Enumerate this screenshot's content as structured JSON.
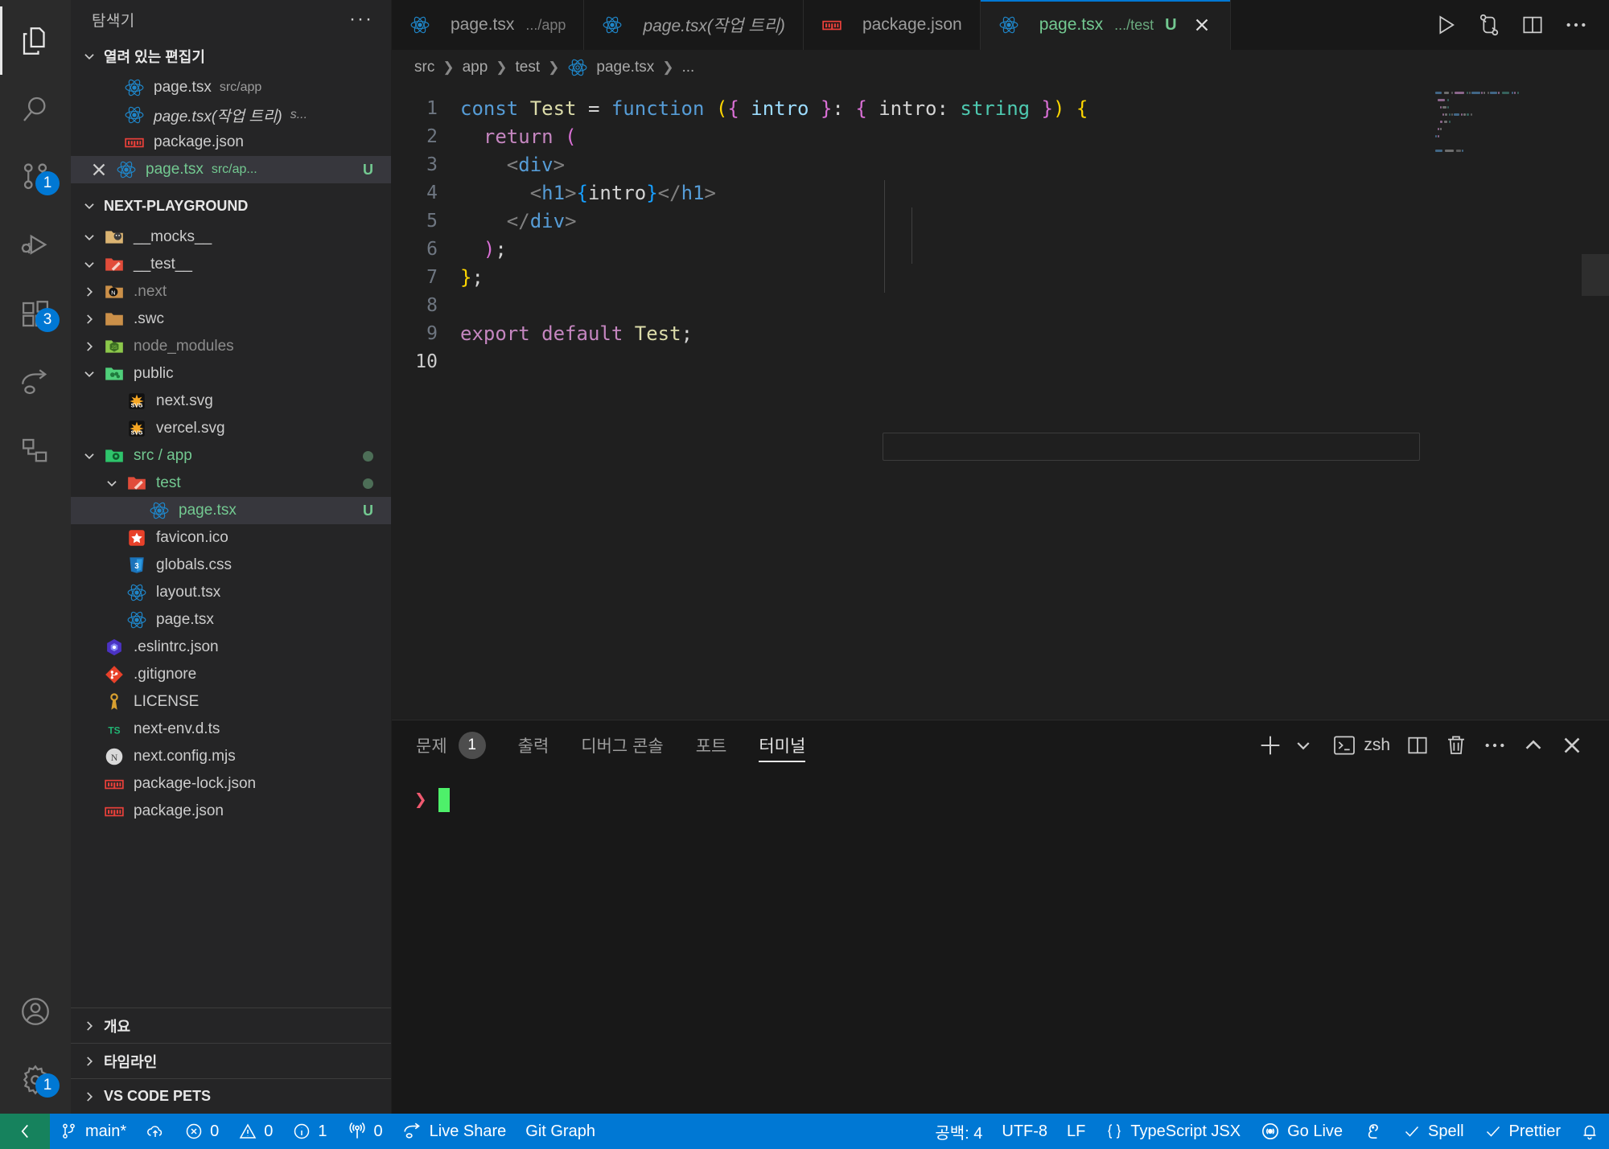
{
  "activity_bar": {
    "items": [
      {
        "name": "explorer",
        "icon": "files-icon",
        "badge": null,
        "active": true
      },
      {
        "name": "search",
        "icon": "search-icon",
        "badge": null,
        "active": false
      },
      {
        "name": "source-control",
        "icon": "source-control-icon",
        "badge": "1",
        "active": false
      },
      {
        "name": "run-and-debug",
        "icon": "debug-icon",
        "badge": null,
        "active": false
      },
      {
        "name": "extensions",
        "icon": "extensions-icon",
        "badge": "3",
        "active": false
      },
      {
        "name": "live-share",
        "icon": "live-share-icon",
        "badge": null,
        "active": false
      },
      {
        "name": "test-explorer",
        "icon": "beaker-nodes-icon",
        "badge": null,
        "active": false
      }
    ],
    "bottom_items": [
      {
        "name": "accounts",
        "icon": "account-icon",
        "badge": null
      },
      {
        "name": "manage",
        "icon": "gear-icon",
        "badge": "1"
      }
    ]
  },
  "sidebar": {
    "title": "탐색기",
    "more_actions": "···",
    "open_editors": {
      "label": "열려 있는 편집기",
      "expanded": true,
      "items": [
        {
          "icon": "react-icon",
          "name": "page.tsx",
          "path": "src/app",
          "italic": false,
          "dirty": false,
          "selected": false,
          "flag": ""
        },
        {
          "icon": "react-icon",
          "name": "page.tsx(작업 트리)",
          "path": "s...",
          "italic": true,
          "dirty": false,
          "selected": false,
          "flag": ""
        },
        {
          "icon": "npm-icon",
          "name": "package.json",
          "path": "",
          "italic": false,
          "dirty": false,
          "selected": false,
          "flag": ""
        },
        {
          "icon": "react-icon",
          "name": "page.tsx",
          "path": "src/ap...",
          "italic": false,
          "dirty": false,
          "selected": true,
          "flag": "U"
        }
      ]
    },
    "project": {
      "label": "NEXT-PLAYGROUND",
      "expanded": true,
      "items": [
        {
          "depth": 1,
          "kind": "folder",
          "icon": "folder-mocks-icon",
          "name": "__mocks__",
          "expanded": true,
          "color": ""
        },
        {
          "depth": 1,
          "kind": "folder",
          "icon": "folder-test-icon",
          "name": "__test__",
          "expanded": true,
          "color": ""
        },
        {
          "depth": 1,
          "kind": "folder",
          "icon": "folder-next-icon",
          "name": ".next",
          "expanded": false,
          "color": "dim"
        },
        {
          "depth": 1,
          "kind": "folder",
          "icon": "folder-plain-icon",
          "name": ".swc",
          "expanded": false,
          "color": ""
        },
        {
          "depth": 1,
          "kind": "folder",
          "icon": "folder-node-icon",
          "name": "node_modules",
          "expanded": false,
          "color": "dim"
        },
        {
          "depth": 1,
          "kind": "folder",
          "icon": "folder-public-icon",
          "name": "public",
          "expanded": true,
          "color": ""
        },
        {
          "depth": 2,
          "kind": "file",
          "icon": "svg-icon",
          "name": "next.svg",
          "expanded": null,
          "color": ""
        },
        {
          "depth": 2,
          "kind": "file",
          "icon": "svg-icon",
          "name": "vercel.svg",
          "expanded": null,
          "color": ""
        },
        {
          "depth": 1,
          "kind": "folder",
          "icon": "folder-src-icon",
          "name": "src / app",
          "expanded": true,
          "color": "green",
          "dot": true
        },
        {
          "depth": 2,
          "kind": "folder",
          "icon": "folder-test-icon",
          "name": "test",
          "expanded": true,
          "color": "green",
          "dot": true
        },
        {
          "depth": 3,
          "kind": "file",
          "icon": "react-icon",
          "name": "page.tsx",
          "expanded": null,
          "color": "green",
          "flag": "U",
          "selected": true
        },
        {
          "depth": 2,
          "kind": "file",
          "icon": "favicon-icon",
          "name": "favicon.ico",
          "expanded": null,
          "color": ""
        },
        {
          "depth": 2,
          "kind": "file",
          "icon": "css-icon",
          "name": "globals.css",
          "expanded": null,
          "color": ""
        },
        {
          "depth": 2,
          "kind": "file",
          "icon": "react-icon",
          "name": "layout.tsx",
          "expanded": null,
          "color": ""
        },
        {
          "depth": 2,
          "kind": "file",
          "icon": "react-icon",
          "name": "page.tsx",
          "expanded": null,
          "color": ""
        },
        {
          "depth": 1,
          "kind": "file",
          "icon": "eslint-icon",
          "name": ".eslintrc.json",
          "expanded": null,
          "color": ""
        },
        {
          "depth": 1,
          "kind": "file",
          "icon": "git-icon",
          "name": ".gitignore",
          "expanded": null,
          "color": ""
        },
        {
          "depth": 1,
          "kind": "file",
          "icon": "license-icon",
          "name": "LICENSE",
          "expanded": null,
          "color": ""
        },
        {
          "depth": 1,
          "kind": "file",
          "icon": "ts-icon",
          "name": "next-env.d.ts",
          "expanded": null,
          "color": ""
        },
        {
          "depth": 1,
          "kind": "file",
          "icon": "next-icon",
          "name": "next.config.mjs",
          "expanded": null,
          "color": ""
        },
        {
          "depth": 1,
          "kind": "file",
          "icon": "npm-icon",
          "name": "package-lock.json",
          "expanded": null,
          "color": ""
        },
        {
          "depth": 1,
          "kind": "file",
          "icon": "npm-icon",
          "name": "package.json",
          "expanded": null,
          "color": ""
        }
      ]
    },
    "bottom_sections": [
      {
        "label": "개요",
        "expanded": false
      },
      {
        "label": "타임라인",
        "expanded": false
      },
      {
        "label": "VS CODE PETS",
        "expanded": false
      }
    ]
  },
  "editor": {
    "tabs": [
      {
        "icon": "react-icon",
        "label": "page.tsx",
        "path": ".../app",
        "italic": false,
        "active": false,
        "flag": "",
        "closable": false
      },
      {
        "icon": "react-icon",
        "label": "page.tsx(작업 트리)",
        "path": "",
        "italic": true,
        "active": false,
        "flag": "",
        "closable": false
      },
      {
        "icon": "npm-icon",
        "label": "package.json",
        "path": "",
        "italic": false,
        "active": false,
        "flag": "",
        "closable": false
      },
      {
        "icon": "react-icon",
        "label": "page.tsx",
        "path": ".../test",
        "italic": false,
        "active": true,
        "flag": "U",
        "closable": true
      }
    ],
    "tab_actions": [
      {
        "name": "run-button",
        "icon": "play-icon"
      },
      {
        "name": "run-and-debug-split-button",
        "icon": "git-compare-icon"
      },
      {
        "name": "split-editor-button",
        "icon": "split-editor-icon"
      },
      {
        "name": "more-actions-button",
        "icon": "ellipsis-icon"
      }
    ],
    "breadcrumb": [
      "src",
      "app",
      "test",
      "page.tsx",
      "..."
    ],
    "breadcrumb_file_icon": "react-icon",
    "language": "TypeScript JSX",
    "lines": [
      {
        "no": "1",
        "tokens": [
          {
            "t": "const",
            "c": "t-key"
          },
          {
            "t": " ",
            "c": "t-plain"
          },
          {
            "t": "Test",
            "c": "t-var"
          },
          {
            "t": " ",
            "c": "t-plain"
          },
          {
            "t": "=",
            "c": "t-op"
          },
          {
            "t": " ",
            "c": "t-plain"
          },
          {
            "t": "function",
            "c": "t-fn"
          },
          {
            "t": " ",
            "c": "t-plain"
          },
          {
            "t": "(",
            "c": "t-brace1"
          },
          {
            "t": "{",
            "c": "t-brace2"
          },
          {
            "t": " intro ",
            "c": "t-param"
          },
          {
            "t": "}",
            "c": "t-brace2"
          },
          {
            "t": ":",
            "c": "t-plain"
          },
          {
            "t": " ",
            "c": "t-plain"
          },
          {
            "t": "{",
            "c": "t-brace2"
          },
          {
            "t": " intro",
            "c": "t-plain"
          },
          {
            "t": ":",
            "c": "t-plain"
          },
          {
            "t": " ",
            "c": "t-plain"
          },
          {
            "t": "string",
            "c": "t-type"
          },
          {
            "t": " ",
            "c": "t-plain"
          },
          {
            "t": "}",
            "c": "t-brace2"
          },
          {
            "t": ")",
            "c": "t-brace1"
          },
          {
            "t": " ",
            "c": "t-plain"
          },
          {
            "t": "{",
            "c": "t-brace1"
          }
        ]
      },
      {
        "no": "2",
        "tokens": [
          {
            "t": "  ",
            "c": "t-plain"
          },
          {
            "t": "return",
            "c": "t-kw2"
          },
          {
            "t": " ",
            "c": "t-plain"
          },
          {
            "t": "(",
            "c": "t-brace2"
          }
        ]
      },
      {
        "no": "3",
        "tokens": [
          {
            "t": "    ",
            "c": "t-plain"
          },
          {
            "t": "<",
            "c": "t-punc"
          },
          {
            "t": "div",
            "c": "t-tag"
          },
          {
            "t": ">",
            "c": "t-punc"
          }
        ]
      },
      {
        "no": "4",
        "tokens": [
          {
            "t": "      ",
            "c": "t-plain"
          },
          {
            "t": "<",
            "c": "t-punc"
          },
          {
            "t": "h1",
            "c": "t-tag"
          },
          {
            "t": ">",
            "c": "t-punc"
          },
          {
            "t": "{",
            "c": "t-brace3"
          },
          {
            "t": "intro",
            "c": "t-plain"
          },
          {
            "t": "}",
            "c": "t-brace3"
          },
          {
            "t": "</",
            "c": "t-punc"
          },
          {
            "t": "h1",
            "c": "t-tag"
          },
          {
            "t": ">",
            "c": "t-punc"
          }
        ]
      },
      {
        "no": "5",
        "tokens": [
          {
            "t": "    ",
            "c": "t-plain"
          },
          {
            "t": "</",
            "c": "t-punc"
          },
          {
            "t": "div",
            "c": "t-tag"
          },
          {
            "t": ">",
            "c": "t-punc"
          }
        ]
      },
      {
        "no": "6",
        "tokens": [
          {
            "t": "  ",
            "c": "t-plain"
          },
          {
            "t": ")",
            "c": "t-brace2"
          },
          {
            "t": ";",
            "c": "t-plain"
          }
        ]
      },
      {
        "no": "7",
        "tokens": [
          {
            "t": "}",
            "c": "t-brace1"
          },
          {
            "t": ";",
            "c": "t-plain"
          }
        ]
      },
      {
        "no": "8",
        "tokens": []
      },
      {
        "no": "9",
        "tokens": [
          {
            "t": "export",
            "c": "t-kw2"
          },
          {
            "t": " ",
            "c": "t-plain"
          },
          {
            "t": "default",
            "c": "t-kw2"
          },
          {
            "t": " ",
            "c": "t-plain"
          },
          {
            "t": "Test",
            "c": "t-var"
          },
          {
            "t": ";",
            "c": "t-plain"
          }
        ]
      },
      {
        "no": "10",
        "tokens": [],
        "current": true
      }
    ]
  },
  "panel": {
    "tabs": [
      {
        "label": "문제",
        "count": "1",
        "active": false
      },
      {
        "label": "출력",
        "count": "",
        "active": false
      },
      {
        "label": "디버그 콘솔",
        "count": "",
        "active": false
      },
      {
        "label": "포트",
        "count": "",
        "active": false
      },
      {
        "label": "터미널",
        "count": "",
        "active": true
      }
    ],
    "actions": {
      "new_terminal": "new-terminal-icon",
      "new_terminal_dropdown": "chevron-down-icon",
      "shell_icon": "terminal-icon",
      "shell_label": "zsh",
      "split": "split-terminal-icon",
      "kill": "trash-icon",
      "more": "ellipsis-icon",
      "maximize": "chevron-up-icon",
      "close": "close-icon"
    },
    "terminal": {
      "prompt": "❯",
      "command": ""
    }
  },
  "status_bar": {
    "remote_icon": "remote-window-icon",
    "left": [
      {
        "icon": "source-control-icon",
        "label": "main*",
        "name": "branch-status"
      },
      {
        "icon": "cloud-upload-icon",
        "label": "",
        "name": "sync-status"
      },
      {
        "icon": "error-icon",
        "label": "0",
        "name": "errors-status"
      },
      {
        "icon": "warning-icon",
        "label": "0",
        "name": "warnings-status"
      },
      {
        "icon": "info-icon",
        "label": "1",
        "name": "infos-status"
      },
      {
        "icon": "radio-tower-icon",
        "label": "0",
        "name": "ports-status"
      },
      {
        "icon": "live-share-icon",
        "label": "Live Share",
        "name": "live-share-status"
      },
      {
        "icon": "",
        "label": "Git Graph",
        "name": "git-graph-status"
      }
    ],
    "right": [
      {
        "icon": "",
        "label": "공백: 4",
        "name": "indentation-status"
      },
      {
        "icon": "",
        "label": "UTF-8",
        "name": "encoding-status"
      },
      {
        "icon": "",
        "label": "LF",
        "name": "eol-status"
      },
      {
        "icon": "braces-icon",
        "label": "TypeScript JSX",
        "name": "language-mode-status"
      },
      {
        "icon": "broadcast-icon",
        "label": "Go Live",
        "name": "go-live-status"
      },
      {
        "icon": "squirrel-icon",
        "label": "",
        "name": "squirrel-status"
      },
      {
        "icon": "check-icon",
        "label": "Spell",
        "name": "spell-status"
      },
      {
        "icon": "check-icon",
        "label": "Prettier",
        "name": "prettier-status"
      },
      {
        "icon": "bell-icon",
        "label": "",
        "name": "notifications-status"
      }
    ]
  },
  "colors": {
    "accent": "#0078d4",
    "remote_green": "#16825d",
    "modified_green": "#73c991",
    "panel_bg": "#181818",
    "editor_bg": "#1f1f1f",
    "sidebar_bg": "#252526"
  }
}
